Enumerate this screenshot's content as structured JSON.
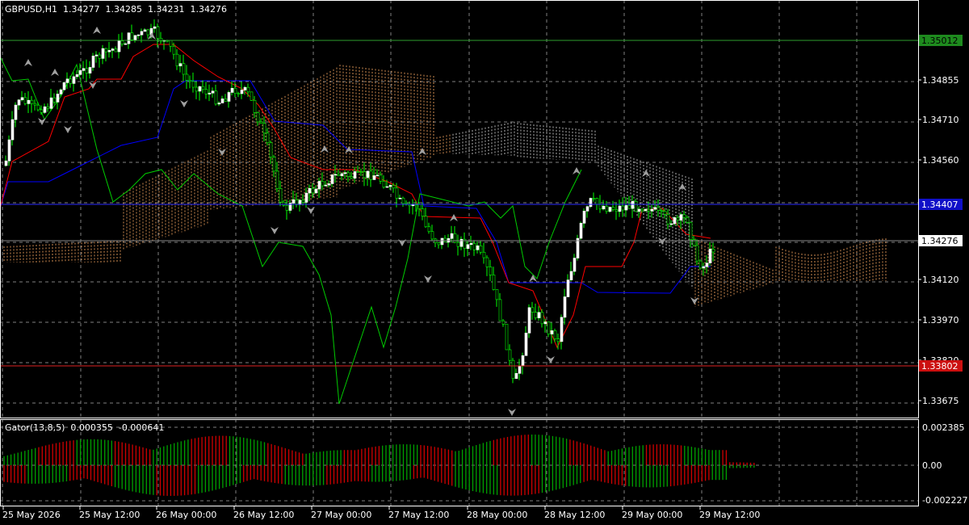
{
  "header": {
    "symbol": "GBPUSD,H1",
    "open": "1.34277",
    "high": "1.34285",
    "low": "1.34231",
    "close": "1.34276"
  },
  "indicator": {
    "name": "Gator(13,8,5)",
    "value1": "0.000355",
    "value2": "-0.000641"
  },
  "price_levels": [
    {
      "label": "1.35012",
      "color": "#1e8a1e",
      "line": "#2e9e2e"
    },
    {
      "label": "1.34407",
      "color": "#1010c8",
      "line": "#2b2bff"
    },
    {
      "label": "1.34276",
      "color": "#ffffff",
      "line": "#888888"
    },
    {
      "label": "1.33802",
      "color": "#cc1010",
      "line": "#dd2222"
    }
  ],
  "y_ticks": [
    "1.34855",
    "1.34710",
    "1.34560",
    "1.34120",
    "1.33970",
    "1.33820",
    "1.33675"
  ],
  "sub_ticks": [
    "0.002385",
    "0.00",
    "-0.002227"
  ],
  "x_ticks": [
    "25 May 2026",
    "25 May 12:00",
    "26 May 00:00",
    "26 May 12:00",
    "27 May 00:00",
    "27 May 12:00",
    "28 May 00:00",
    "28 May 12:00",
    "29 May 00:00",
    "29 May 12:00"
  ],
  "colors": {
    "background": "#000000",
    "grid": "#808080",
    "bull_candle": "#ffffff",
    "bear_candle": "#00ff00",
    "tenkan": "#ff0000",
    "kijun": "#0000ff",
    "chikou": "#00cc00",
    "cloud_a": "#f4a460",
    "cloud_b": "#d2d2d2",
    "gator_up": "#00a000",
    "gator_down": "#d00000"
  }
}
